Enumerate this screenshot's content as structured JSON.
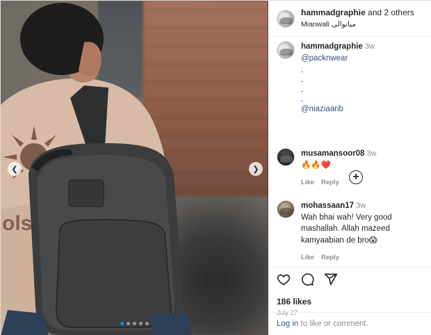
{
  "header": {
    "username": "hammadgraphie",
    "others_text": " and 2 others",
    "location": "Mianwali میانوالی"
  },
  "caption": {
    "username": "hammadgraphie",
    "time": "3w",
    "mention1": "@packnwear",
    "dots": [
      ".",
      ".",
      ".",
      "."
    ],
    "mention2": "@niaziaarib"
  },
  "comments": [
    {
      "username": "musamansoor08",
      "time": "3w",
      "text": "🔥🔥❤️",
      "like_label": "Like",
      "reply_label": "Reply"
    },
    {
      "username": "mohassaan17",
      "time": "3w",
      "text": "Wah bhai wah! Very good mashallah. Allah mazeed kamyaabian de bro😱",
      "like_label": "Like",
      "reply_label": "Reply"
    }
  ],
  "media": {
    "prev_icon": "chevron-left-icon",
    "next_icon": "chevron-right-icon",
    "carousel_total": 5,
    "carousel_current": 1
  },
  "actions": {
    "likes": "186 likes",
    "date": "July 27"
  },
  "login": {
    "link": "Log in",
    "text": " to like or comment."
  },
  "colors": {
    "accent": "#0095f6",
    "link": "#385185",
    "muted": "#8e8e8e",
    "text": "#262626"
  }
}
